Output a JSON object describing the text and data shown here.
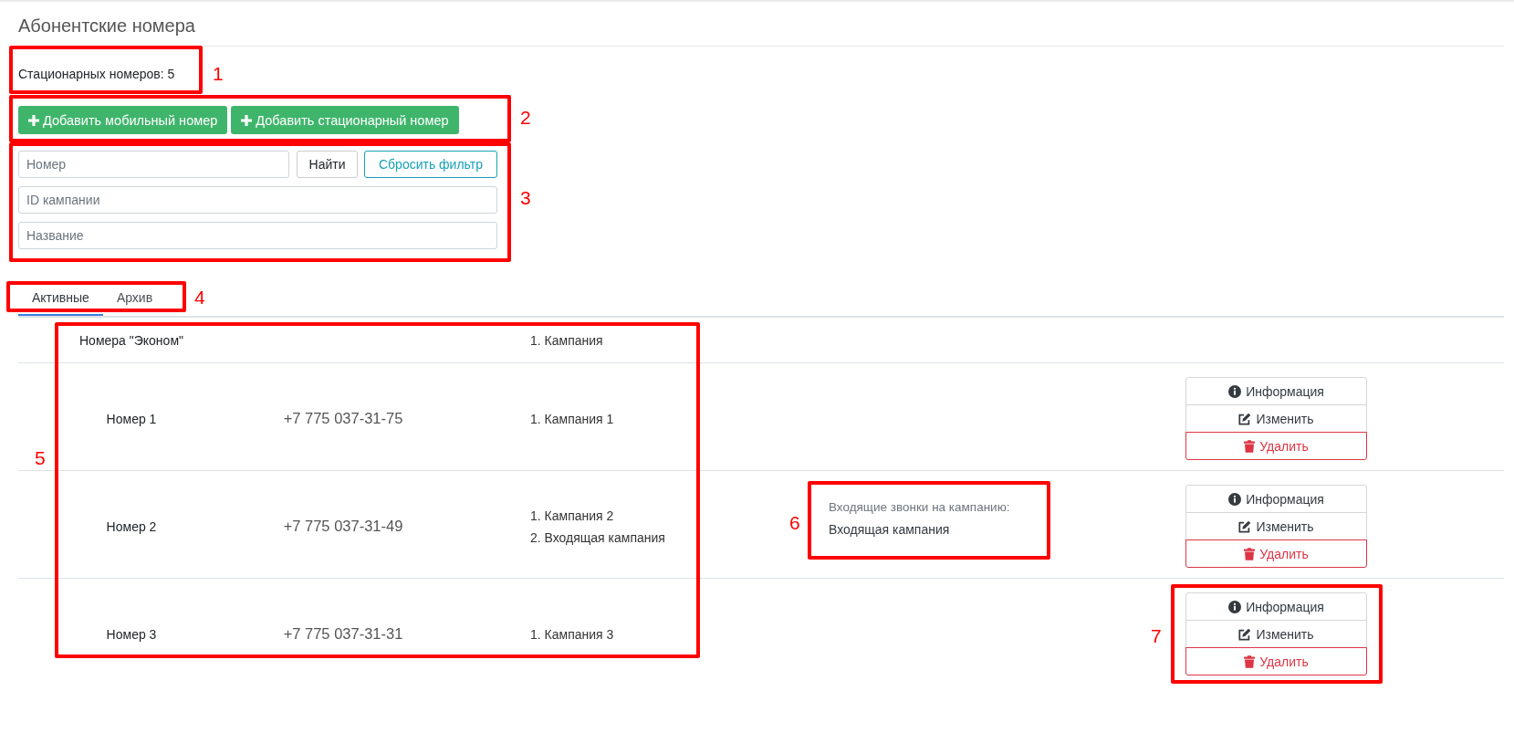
{
  "page": {
    "title": "Абонентские номера"
  },
  "summary": {
    "text": "Стационарных номеров: 5",
    "callout": "1"
  },
  "add_actions": {
    "buttons": [
      {
        "label": "Добавить мобильный номер"
      },
      {
        "label": "Добавить стационарный номер"
      }
    ],
    "callout": "2"
  },
  "filter": {
    "search_row": {
      "field": {
        "placeholder": "Номер"
      },
      "buttons": [
        {
          "kind": "search",
          "label": "Найти"
        },
        {
          "kind": "reset",
          "label": "Сбросить фильтр"
        }
      ]
    },
    "fields": [
      {
        "placeholder": "ID кампании"
      },
      {
        "placeholder": "Название"
      }
    ],
    "callout": "3"
  },
  "tabs": {
    "items": [
      {
        "label": "Активные",
        "selected": true
      },
      {
        "label": "Архив",
        "selected": false
      }
    ],
    "callout": "4"
  },
  "table": {
    "callout": "5",
    "group": {
      "name": "Номера \"Эконом\"",
      "campaigns": [
        "1. Кампания"
      ]
    },
    "rows": [
      {
        "name": "Номер 1",
        "phone": "+7 775 037-31-75",
        "campaigns": [
          "1. Кампания 1"
        ],
        "actions": [
          {
            "kind": "info",
            "label": "Информация"
          },
          {
            "kind": "edit",
            "label": "Изменить"
          },
          {
            "kind": "delete",
            "label": "Удалить"
          }
        ]
      },
      {
        "name": "Номер 2",
        "phone": "+7 775 037-31-49",
        "campaigns": [
          "1. Кампания 2",
          "2. Входящая кампания"
        ],
        "incoming": {
          "caption": "Входящие звонки на кампанию:",
          "value": "Входящая кампания",
          "callout": "6"
        },
        "actions": [
          {
            "kind": "info",
            "label": "Информация"
          },
          {
            "kind": "edit",
            "label": "Изменить"
          },
          {
            "kind": "delete",
            "label": "Удалить"
          }
        ]
      },
      {
        "name": "Номер 3",
        "phone": "+7 775 037-31-31",
        "campaigns": [
          "1. Кампания 3"
        ],
        "actions": [
          {
            "kind": "info",
            "label": "Информация"
          },
          {
            "kind": "edit",
            "label": "Изменить"
          },
          {
            "kind": "delete",
            "label": "Удалить"
          }
        ],
        "actions_callout": "7"
      }
    ]
  }
}
